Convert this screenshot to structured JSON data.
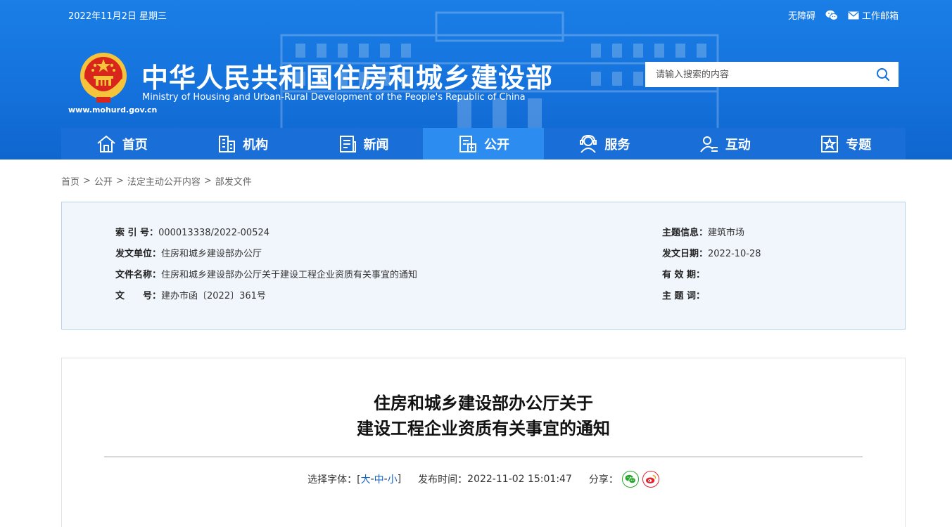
{
  "header": {
    "date": "2022年11月2日 星期三",
    "accessibility_link": "无障碍",
    "work_mail_link": "工作邮箱",
    "title": "中华人民共和国住房和城乡建设部",
    "subtitle": "Ministry of Housing and Urban-Rural Development of the People's Republic of China",
    "domain": "www.mohurd.gov.cn",
    "search_placeholder": "请输入搜索的内容",
    "colors": {
      "header_bg": "#1572dc",
      "nav_bg": "#1a6ed8",
      "nav_active": "#2d8cf0"
    }
  },
  "nav": {
    "items": [
      {
        "label": "首页",
        "icon": "home-icon"
      },
      {
        "label": "机构",
        "icon": "building-icon"
      },
      {
        "label": "新闻",
        "icon": "news-icon"
      },
      {
        "label": "公开",
        "icon": "open-docs-icon",
        "active": true
      },
      {
        "label": "服务",
        "icon": "service-icon"
      },
      {
        "label": "互动",
        "icon": "interaction-icon"
      },
      {
        "label": "专题",
        "icon": "star-icon"
      }
    ]
  },
  "breadcrumb": {
    "items": [
      "首页",
      "公开",
      "法定主动公开内容",
      "部发文件"
    ],
    "separator": ">"
  },
  "info": {
    "index_label": "索 引 号：",
    "index_value": "000013338/2022-00524",
    "issuer_label": "发文单位：",
    "issuer_value": "住房和城乡建设部办公厅",
    "doc_name_label": "文件名称：",
    "doc_name_value": "住房和城乡建设部办公厅关于建设工程企业资质有关事宜的通知",
    "doc_no_label": "文　　号：",
    "doc_no_value": "建办市函〔2022〕361号",
    "topic_label": "主题信息：",
    "topic_value": "建筑市场",
    "date_label": "发文日期：",
    "date_value": "2022-10-28",
    "validity_label": "有 效 期：",
    "validity_value": "",
    "keywords_label": "主 题 词：",
    "keywords_value": ""
  },
  "article": {
    "title_line1": "住房和城乡建设部办公厅关于",
    "title_line2": "建设工程企业资质有关事宜的通知",
    "font_label": "选择字体：[",
    "font_large": "大",
    "font_medium": "中",
    "font_small": "小",
    "font_sep": "-",
    "font_close": "]",
    "publish_label": "发布时间：",
    "publish_time": "2022-11-02 15:01:47",
    "share_label": "分享：",
    "share_icons": [
      "wechat-share-icon",
      "weibo-share-icon"
    ]
  }
}
